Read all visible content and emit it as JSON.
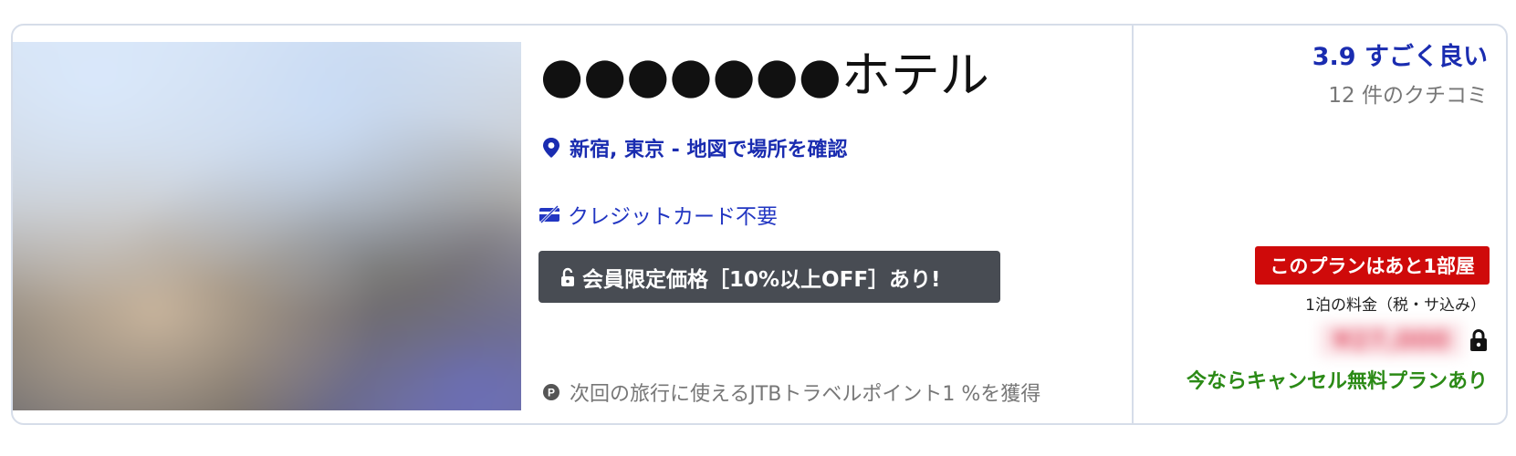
{
  "hotel": {
    "name": "●●●●●●●ホテル",
    "location": "新宿, 東京 - 地図で場所を確認",
    "credit_card": "クレジットカード不要",
    "member_price": "会員限定価格［10%以上OFF］あり!",
    "points_note": "次回の旅行に使えるJTBトラベルポイント1 %を獲得"
  },
  "rating": {
    "score_text": "3.9 すごく良い",
    "reviews_text": "12 件のクチコミ"
  },
  "pricing": {
    "rooms_left": "このプランはあと1部屋",
    "price_note": "1泊の料金（税・サ込み）",
    "price_hidden": "¥27,000",
    "cancel_note": "今ならキャンセル無料プランあり"
  },
  "icons": {
    "location": "map-pin-icon",
    "credit": "no-credit-card-icon",
    "member": "lock-open-icon",
    "points": "points-icon",
    "price_lock": "lock-icon"
  },
  "colors": {
    "link_blue": "#1a2cb0",
    "badge_red": "#cf0a0a",
    "member_button": "#484c53",
    "cancel_green": "#2b8a16"
  }
}
